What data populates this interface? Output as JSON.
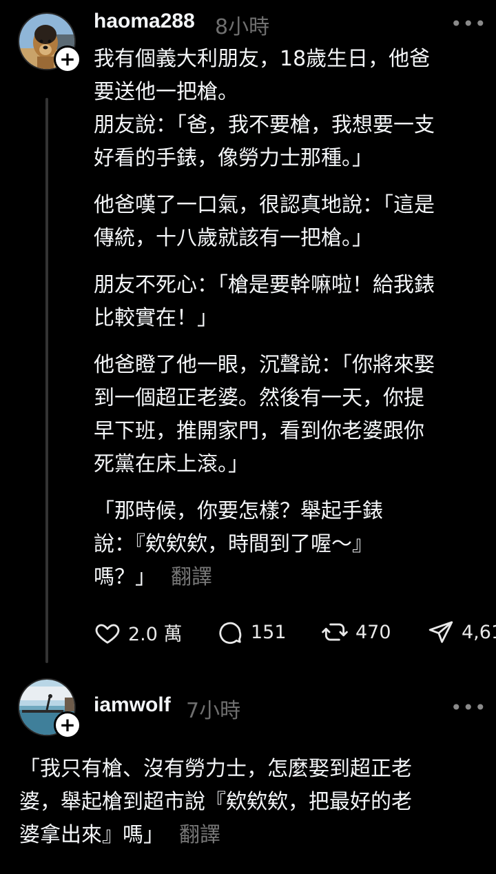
{
  "post1": {
    "username": "haoma288",
    "time": "8小時",
    "more": "•••",
    "paragraphs": [
      "我有個義大利朋友，18歲生日，他爸\n要送他一把槍。\n朋友說：「爸，我不要槍，我想要一支\n好看的手錶，像勞力士那種。」",
      "他爸嘆了一口氣，很認真地說：「這是\n傳統，十八歲就該有一把槍。」",
      "朋友不死心：「槍是要幹嘛啦！給我錶\n比較實在！」",
      "他爸瞪了他一眼，沉聲說：「你將來娶\n到一個超正老婆。然後有一天，你提\n早下班，推開家門，看到你老婆跟你\n死黨在床上滾。」",
      "「那時候，你要怎樣？舉起手錶\n說：『欸欸欸，時間到了喔～』\n嗎？」"
    ],
    "translate": "翻譯",
    "likes": "2.0 萬",
    "comments": "151",
    "reposts": "470",
    "shares": "4,61"
  },
  "post2": {
    "username": "iamwolf",
    "time": "7小時",
    "more": "•••",
    "text": "「我只有槍、沒有勞力士，怎麼娶到超正老\n婆，舉起槍到超市說『欸欸欸，把最好的老\n婆拿出來』嗎」",
    "translate": "翻譯"
  }
}
